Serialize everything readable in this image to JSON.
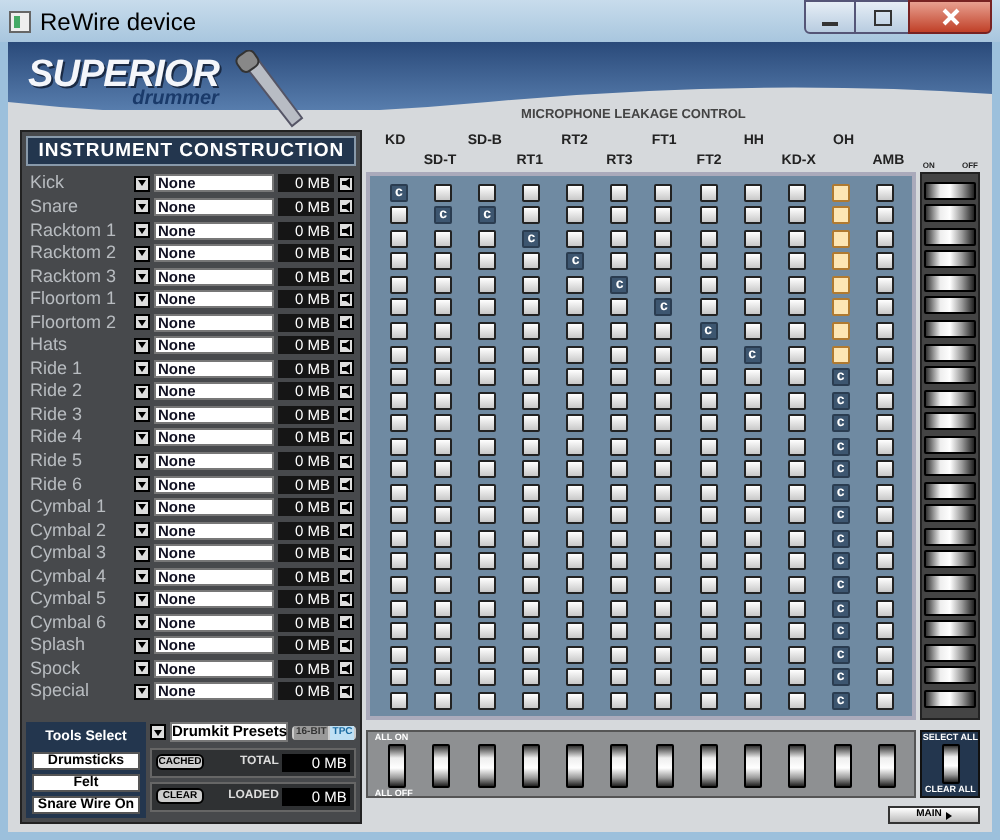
{
  "window": {
    "title": "ReWire device"
  },
  "logo": {
    "brand": "SUPERIOR",
    "sub": "drummer"
  },
  "instrument_panel": {
    "title": "INSTRUMENT CONSTRUCTION",
    "instruments": [
      {
        "name": "Kick",
        "sample": "None",
        "size": "0 MB"
      },
      {
        "name": "Snare",
        "sample": "None",
        "size": "0 MB"
      },
      {
        "name": "Racktom 1",
        "sample": "None",
        "size": "0 MB"
      },
      {
        "name": "Racktom 2",
        "sample": "None",
        "size": "0 MB"
      },
      {
        "name": "Racktom 3",
        "sample": "None",
        "size": "0 MB"
      },
      {
        "name": "Floortom 1",
        "sample": "None",
        "size": "0 MB"
      },
      {
        "name": "Floortom 2",
        "sample": "None",
        "size": "0 MB"
      },
      {
        "name": "Hats",
        "sample": "None",
        "size": "0 MB"
      },
      {
        "name": "Ride 1",
        "sample": "None",
        "size": "0 MB"
      },
      {
        "name": "Ride 2",
        "sample": "None",
        "size": "0 MB"
      },
      {
        "name": "Ride 3",
        "sample": "None",
        "size": "0 MB"
      },
      {
        "name": "Ride 4",
        "sample": "None",
        "size": "0 MB"
      },
      {
        "name": "Ride 5",
        "sample": "None",
        "size": "0 MB"
      },
      {
        "name": "Ride 6",
        "sample": "None",
        "size": "0 MB"
      },
      {
        "name": "Cymbal 1",
        "sample": "None",
        "size": "0 MB"
      },
      {
        "name": "Cymbal 2",
        "sample": "None",
        "size": "0 MB"
      },
      {
        "name": "Cymbal 3",
        "sample": "None",
        "size": "0 MB"
      },
      {
        "name": "Cymbal 4",
        "sample": "None",
        "size": "0 MB"
      },
      {
        "name": "Cymbal 5",
        "sample": "None",
        "size": "0 MB"
      },
      {
        "name": "Cymbal 6",
        "sample": "None",
        "size": "0 MB"
      },
      {
        "name": "Splash",
        "sample": "None",
        "size": "0 MB"
      },
      {
        "name": "Spock",
        "sample": "None",
        "size": "0 MB"
      },
      {
        "name": "Special",
        "sample": "None",
        "size": "0 MB"
      }
    ]
  },
  "tools": {
    "tab": "Tools Select",
    "items": [
      "Drumsticks",
      "Felt",
      "Snare Wire On"
    ],
    "preset": "Drumkit Presets",
    "modes": [
      {
        "label": "16-BIT",
        "selected": false
      },
      {
        "label": "TPC",
        "selected": true
      }
    ],
    "cached_button": "CACHED",
    "total_label": "TOTAL",
    "total": "0 MB",
    "clear_button": "CLEAR",
    "loaded_label": "LOADED",
    "loaded": "0 MB"
  },
  "leakage": {
    "title": "MICROPHONE LEAKAGE CONTROL",
    "mics": [
      "KD",
      "SD-T",
      "SD-B",
      "RT1",
      "RT2",
      "RT3",
      "FT1",
      "FT2",
      "HH",
      "KD-X",
      "OH",
      "AMB"
    ],
    "on_label": "ON",
    "off_label": "OFF",
    "rows": [
      {
        "on": true,
        "cells": [
          {
            "label": "c"
          },
          {
            "lit": false
          },
          {
            "lit": false
          },
          {
            "lit": false
          },
          {
            "lit": false
          },
          {
            "lit": false
          },
          {
            "lit": false
          },
          {
            "lit": false
          },
          {
            "lit": false
          },
          {
            "lit": false
          },
          {
            "lit": true
          },
          {
            "lit": false
          }
        ]
      },
      {
        "on": true,
        "cells": [
          {
            "lit": false
          },
          {
            "label": "c"
          },
          {
            "label": "c"
          },
          {
            "lit": false
          },
          {
            "lit": false
          },
          {
            "lit": false
          },
          {
            "lit": false
          },
          {
            "lit": false
          },
          {
            "lit": false
          },
          {
            "lit": false
          },
          {
            "lit": true
          },
          {
            "lit": false
          }
        ]
      },
      {
        "on": true,
        "cells": [
          {
            "lit": false
          },
          {
            "lit": false
          },
          {
            "lit": false
          },
          {
            "label": "c"
          },
          {
            "lit": false
          },
          {
            "lit": false
          },
          {
            "lit": false
          },
          {
            "lit": false
          },
          {
            "lit": false
          },
          {
            "lit": false
          },
          {
            "lit": true
          },
          {
            "lit": false
          }
        ]
      },
      {
        "on": true,
        "cells": [
          {
            "lit": false
          },
          {
            "lit": false
          },
          {
            "lit": false
          },
          {
            "lit": false
          },
          {
            "label": "c"
          },
          {
            "lit": false
          },
          {
            "lit": false
          },
          {
            "lit": false
          },
          {
            "lit": false
          },
          {
            "lit": false
          },
          {
            "lit": true
          },
          {
            "lit": false
          }
        ]
      },
      {
        "on": true,
        "cells": [
          {
            "lit": false
          },
          {
            "lit": false
          },
          {
            "lit": false
          },
          {
            "lit": false
          },
          {
            "lit": false
          },
          {
            "label": "c"
          },
          {
            "lit": false
          },
          {
            "lit": false
          },
          {
            "lit": false
          },
          {
            "lit": false
          },
          {
            "lit": true
          },
          {
            "lit": false
          }
        ]
      },
      {
        "on": true,
        "cells": [
          {
            "lit": false
          },
          {
            "lit": false
          },
          {
            "lit": false
          },
          {
            "lit": false
          },
          {
            "lit": false
          },
          {
            "lit": false
          },
          {
            "label": "c"
          },
          {
            "lit": false
          },
          {
            "lit": false
          },
          {
            "lit": false
          },
          {
            "lit": true
          },
          {
            "lit": false
          }
        ]
      },
      {
        "on": true,
        "cells": [
          {
            "lit": false
          },
          {
            "lit": false
          },
          {
            "lit": false
          },
          {
            "lit": false
          },
          {
            "lit": false
          },
          {
            "lit": false
          },
          {
            "lit": false
          },
          {
            "label": "c"
          },
          {
            "lit": false
          },
          {
            "lit": false
          },
          {
            "lit": true
          },
          {
            "lit": false
          }
        ]
      },
      {
        "on": true,
        "cells": [
          {
            "lit": false
          },
          {
            "lit": false
          },
          {
            "lit": false
          },
          {
            "lit": false
          },
          {
            "lit": false
          },
          {
            "lit": false
          },
          {
            "lit": false
          },
          {
            "lit": false
          },
          {
            "label": "c"
          },
          {
            "lit": false
          },
          {
            "lit": true
          },
          {
            "lit": false
          }
        ]
      },
      {
        "on": true,
        "cells": [
          {
            "lit": false
          },
          {
            "lit": false
          },
          {
            "lit": false
          },
          {
            "lit": false
          },
          {
            "lit": false
          },
          {
            "lit": false
          },
          {
            "lit": false
          },
          {
            "lit": false
          },
          {
            "lit": false
          },
          {
            "lit": false
          },
          {
            "label": "c"
          },
          {
            "lit": false
          }
        ]
      },
      {
        "on": true,
        "cells": [
          {
            "lit": false
          },
          {
            "lit": false
          },
          {
            "lit": false
          },
          {
            "lit": false
          },
          {
            "lit": false
          },
          {
            "lit": false
          },
          {
            "lit": false
          },
          {
            "lit": false
          },
          {
            "lit": false
          },
          {
            "lit": false
          },
          {
            "label": "c"
          },
          {
            "lit": false
          }
        ]
      },
      {
        "on": true,
        "cells": [
          {
            "lit": false
          },
          {
            "lit": false
          },
          {
            "lit": false
          },
          {
            "lit": false
          },
          {
            "lit": false
          },
          {
            "lit": false
          },
          {
            "lit": false
          },
          {
            "lit": false
          },
          {
            "lit": false
          },
          {
            "lit": false
          },
          {
            "label": "c"
          },
          {
            "lit": false
          }
        ]
      },
      {
        "on": true,
        "cells": [
          {
            "lit": false
          },
          {
            "lit": false
          },
          {
            "lit": false
          },
          {
            "lit": false
          },
          {
            "lit": false
          },
          {
            "lit": false
          },
          {
            "lit": false
          },
          {
            "lit": false
          },
          {
            "lit": false
          },
          {
            "lit": false
          },
          {
            "label": "c"
          },
          {
            "lit": false
          }
        ]
      },
      {
        "on": true,
        "cells": [
          {
            "lit": false
          },
          {
            "lit": false
          },
          {
            "lit": false
          },
          {
            "lit": false
          },
          {
            "lit": false
          },
          {
            "lit": false
          },
          {
            "lit": false
          },
          {
            "lit": false
          },
          {
            "lit": false
          },
          {
            "lit": false
          },
          {
            "label": "c"
          },
          {
            "lit": false
          }
        ]
      },
      {
        "on": true,
        "cells": [
          {
            "lit": false
          },
          {
            "lit": false
          },
          {
            "lit": false
          },
          {
            "lit": false
          },
          {
            "lit": false
          },
          {
            "lit": false
          },
          {
            "lit": false
          },
          {
            "lit": false
          },
          {
            "lit": false
          },
          {
            "lit": false
          },
          {
            "label": "c"
          },
          {
            "lit": false
          }
        ]
      },
      {
        "on": true,
        "cells": [
          {
            "lit": false
          },
          {
            "lit": false
          },
          {
            "lit": false
          },
          {
            "lit": false
          },
          {
            "lit": false
          },
          {
            "lit": false
          },
          {
            "lit": false
          },
          {
            "lit": false
          },
          {
            "lit": false
          },
          {
            "lit": false
          },
          {
            "label": "c"
          },
          {
            "lit": false
          }
        ]
      },
      {
        "on": true,
        "cells": [
          {
            "lit": false
          },
          {
            "lit": false
          },
          {
            "lit": false
          },
          {
            "lit": false
          },
          {
            "lit": false
          },
          {
            "lit": false
          },
          {
            "lit": false
          },
          {
            "lit": false
          },
          {
            "lit": false
          },
          {
            "lit": false
          },
          {
            "label": "c"
          },
          {
            "lit": false
          }
        ]
      },
      {
        "on": true,
        "cells": [
          {
            "lit": false
          },
          {
            "lit": false
          },
          {
            "lit": false
          },
          {
            "lit": false
          },
          {
            "lit": false
          },
          {
            "lit": false
          },
          {
            "lit": false
          },
          {
            "lit": false
          },
          {
            "lit": false
          },
          {
            "lit": false
          },
          {
            "label": "c"
          },
          {
            "lit": false
          }
        ]
      },
      {
        "on": true,
        "cells": [
          {
            "lit": false
          },
          {
            "lit": false
          },
          {
            "lit": false
          },
          {
            "lit": false
          },
          {
            "lit": false
          },
          {
            "lit": false
          },
          {
            "lit": false
          },
          {
            "lit": false
          },
          {
            "lit": false
          },
          {
            "lit": false
          },
          {
            "label": "c"
          },
          {
            "lit": false
          }
        ]
      },
      {
        "on": true,
        "cells": [
          {
            "lit": false
          },
          {
            "lit": false
          },
          {
            "lit": false
          },
          {
            "lit": false
          },
          {
            "lit": false
          },
          {
            "lit": false
          },
          {
            "lit": false
          },
          {
            "lit": false
          },
          {
            "lit": false
          },
          {
            "lit": false
          },
          {
            "label": "c"
          },
          {
            "lit": false
          }
        ]
      },
      {
        "on": true,
        "cells": [
          {
            "lit": false
          },
          {
            "lit": false
          },
          {
            "lit": false
          },
          {
            "lit": false
          },
          {
            "lit": false
          },
          {
            "lit": false
          },
          {
            "lit": false
          },
          {
            "lit": false
          },
          {
            "lit": false
          },
          {
            "lit": false
          },
          {
            "label": "c"
          },
          {
            "lit": false
          }
        ]
      },
      {
        "on": true,
        "cells": [
          {
            "lit": false
          },
          {
            "lit": false
          },
          {
            "lit": false
          },
          {
            "lit": false
          },
          {
            "lit": false
          },
          {
            "lit": false
          },
          {
            "lit": false
          },
          {
            "lit": false
          },
          {
            "lit": false
          },
          {
            "lit": false
          },
          {
            "label": "c"
          },
          {
            "lit": false
          }
        ]
      },
      {
        "on": true,
        "cells": [
          {
            "lit": false
          },
          {
            "lit": false
          },
          {
            "lit": false
          },
          {
            "lit": false
          },
          {
            "lit": false
          },
          {
            "lit": false
          },
          {
            "lit": false
          },
          {
            "lit": false
          },
          {
            "lit": false
          },
          {
            "lit": false
          },
          {
            "label": "c"
          },
          {
            "lit": false
          }
        ]
      },
      {
        "on": true,
        "cells": [
          {
            "lit": false
          },
          {
            "lit": false
          },
          {
            "lit": false
          },
          {
            "lit": false
          },
          {
            "lit": false
          },
          {
            "lit": false
          },
          {
            "lit": false
          },
          {
            "lit": false
          },
          {
            "lit": false
          },
          {
            "lit": false
          },
          {
            "label": "c"
          },
          {
            "lit": false
          }
        ]
      }
    ],
    "column_switches": [
      {
        "on": true
      },
      {
        "on": true
      },
      {
        "on": true
      },
      {
        "on": true
      },
      {
        "on": true
      },
      {
        "on": true
      },
      {
        "on": true
      },
      {
        "on": true
      },
      {
        "on": true
      },
      {
        "on": true
      },
      {
        "on": true
      },
      {
        "on": true
      }
    ],
    "master_on": true,
    "all_on": "ALL ON",
    "all_off": "ALL OFF",
    "select_all": "SELECT ALL",
    "clear_all": "CLEAR ALL"
  },
  "main_button": "MAIN"
}
